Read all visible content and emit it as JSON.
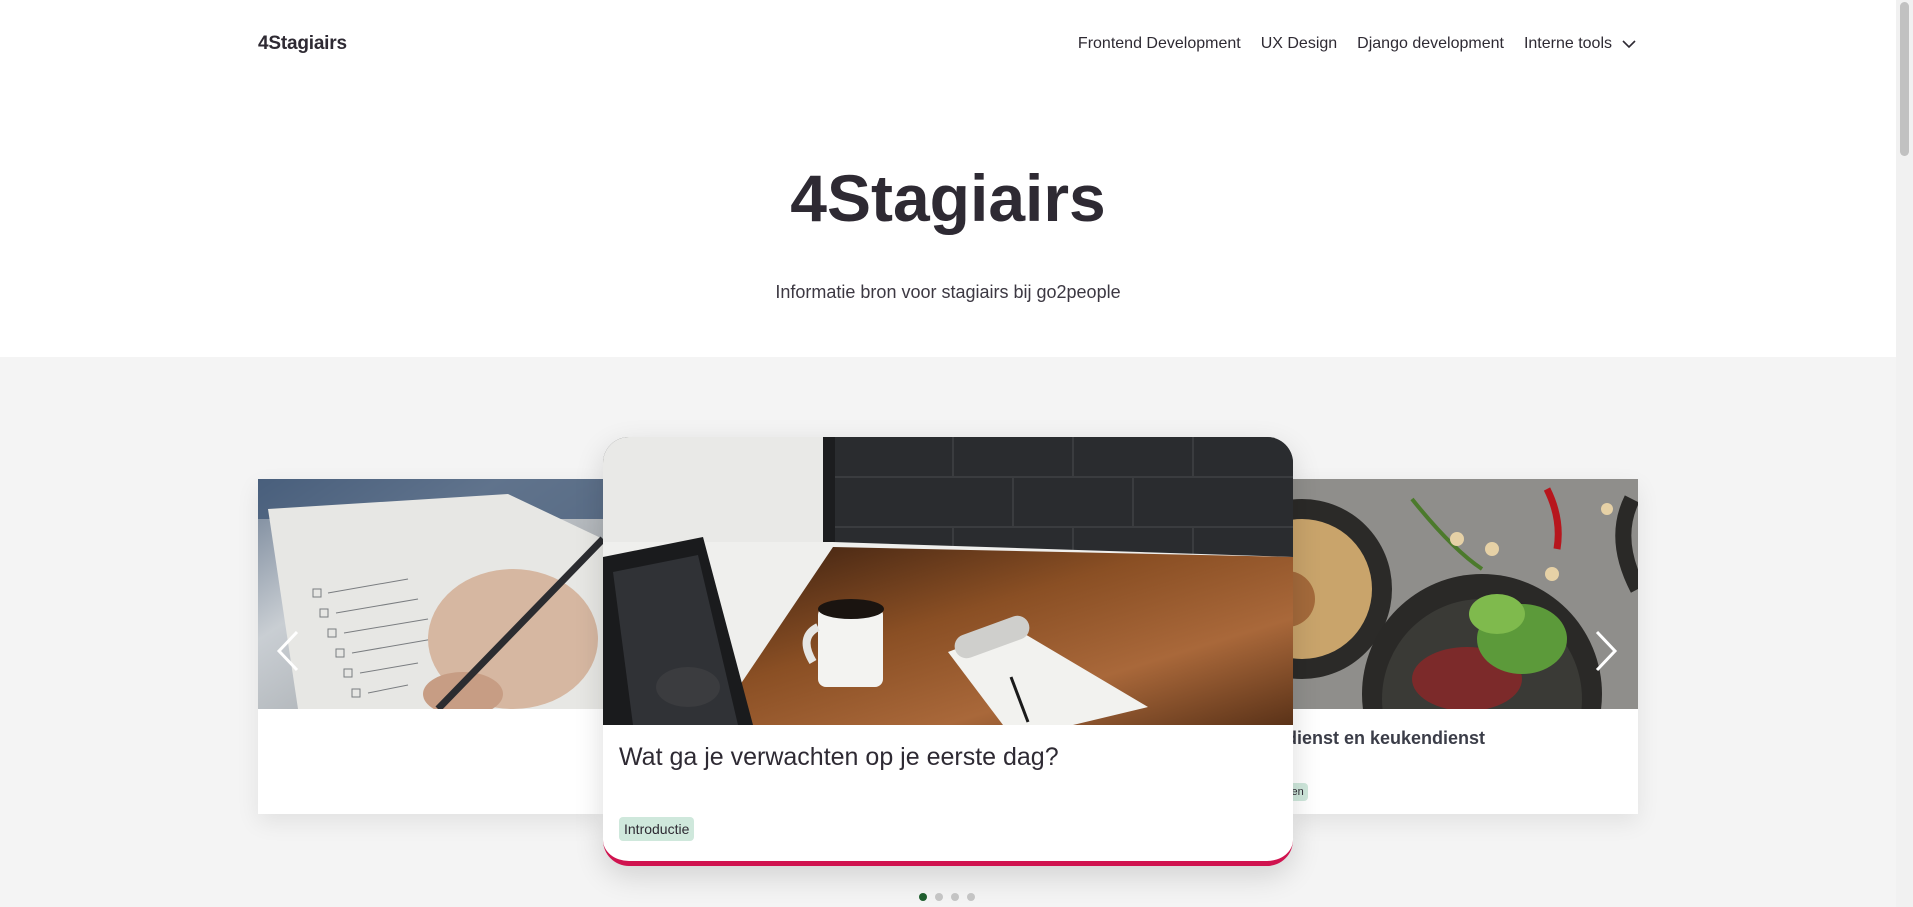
{
  "nav": {
    "brand": "4Stagiairs",
    "items": [
      "Frontend Development",
      "UX Design",
      "Django development"
    ],
    "dropdown_label": "Interne tools"
  },
  "hero": {
    "title": "4Stagiairs",
    "subtitle": "Informatie bron voor stagiairs bij go2people"
  },
  "carousel": {
    "active_card": {
      "title": "Wat ga je verwachten op je eerste dag?",
      "tag": "Introductie"
    },
    "right_card": {
      "title": "dienst en keukendienst",
      "tag": "ken"
    },
    "dots": 4,
    "active_dot": 1
  },
  "colors": {
    "accent": "#d0134f",
    "tag_bg": "#cfe8dc",
    "active_dot": "#1f5e2e",
    "band_bg": "#f4f4f4"
  },
  "icons": [
    "chevron-down-icon",
    "arrow-left-icon",
    "arrow-right-icon"
  ]
}
